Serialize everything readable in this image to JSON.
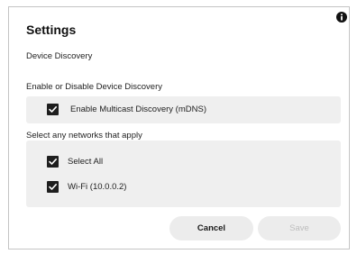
{
  "dialog": {
    "title": "Settings",
    "subtitle": "Device Discovery",
    "info_icon": "info-icon"
  },
  "discovery": {
    "label": "Enable or Disable Device Discovery",
    "option": {
      "label": "Enable Multicast Discovery (mDNS)",
      "checked": true
    }
  },
  "networks": {
    "label": "Select any networks that apply",
    "items": [
      {
        "label": "Select All",
        "checked": true
      },
      {
        "label": "Wi-Fi (10.0.0.2)",
        "checked": true
      }
    ]
  },
  "actions": {
    "cancel_label": "Cancel",
    "save_label": "Save",
    "save_enabled": false
  },
  "colors": {
    "checkbox": "#1e1e1e",
    "panel": "#efefef",
    "button": "#ececec",
    "disabled_text": "#bdbdbd"
  }
}
